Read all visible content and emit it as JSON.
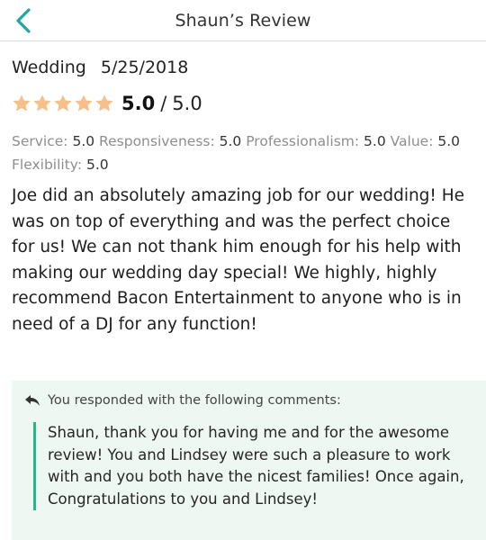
{
  "header": {
    "title": "Shaun’s Review",
    "back_icon": "chevron-left-icon",
    "accent_color": "#1fa7a0"
  },
  "review": {
    "event_type": "Wedding",
    "date": "5/25/2018",
    "star_count": 5,
    "star_color": "#f7c08a",
    "score": "5.0",
    "score_separator": "/",
    "score_max": "5.0",
    "sub_ratings": [
      {
        "label": "Service:",
        "value": "5.0"
      },
      {
        "label": "Responsiveness:",
        "value": "5.0"
      },
      {
        "label": "Professionalism:",
        "value": "5.0"
      },
      {
        "label": "Value:",
        "value": "5.0"
      },
      {
        "label": "Flexibility:",
        "value": "5.0"
      }
    ],
    "text": "Joe did an absolutely amazing job for our wedding! He was on top of everything and was the perfect choice for us!  We can not thank him enough for his help with making our wedding day special!  We highly, highly recommend Bacon Entertainment to anyone who is in need of a DJ for any function!"
  },
  "response": {
    "heading": "You responded with the following comments:",
    "icon": "reply-arrow-icon",
    "text": "Shaun, thank you for having me and for the awesome review! You and Lindsey were such a pleasure to work with and you both have the nicest families! Once again, Congratulations to you and Lindsey!",
    "background_color": "#eef7f2",
    "bar_color": "#1fbc87"
  }
}
